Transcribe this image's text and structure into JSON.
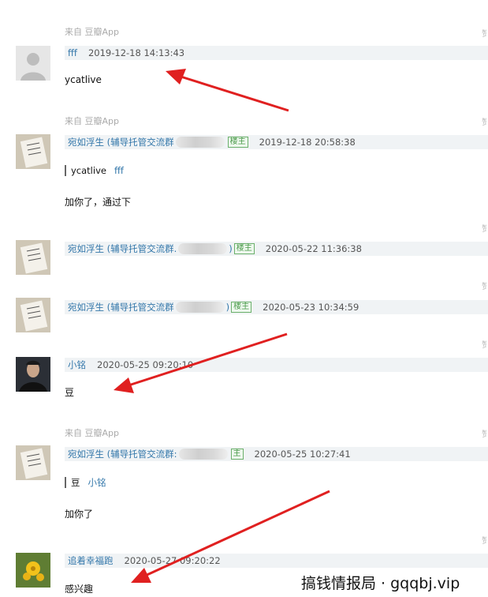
{
  "source_label": "来自 豆瓣App",
  "corner_glyph": "赞",
  "comments": [
    {
      "name": "fff",
      "time": "2019-12-18 14:13:43",
      "content": "ycatlive"
    },
    {
      "name": "宛如浮生 (辅导托管交流群",
      "time": "2019-12-18 20:58:38",
      "badge": "楼主",
      "quote_text": "ycatlive",
      "quote_name": "fff",
      "content": "加你了，通过下"
    },
    {
      "name": "宛如浮生 (辅导托管交流群.",
      "close_paren": ")",
      "time": "2020-05-22 11:36:38",
      "badge": "楼主"
    },
    {
      "name": "宛如浮生 (辅导托管交流群",
      "close_paren": ")",
      "time": "2020-05-23 10:34:59",
      "badge": "楼主"
    },
    {
      "name": "小铭",
      "time": "2020-05-25 09:20:10",
      "content": "豆"
    },
    {
      "name": "宛如浮生 (辅导托管交流群:",
      "time": "2020-05-25 10:27:41",
      "badge": "主",
      "quote_text": "豆",
      "quote_name": "小铭",
      "content": "加你了"
    },
    {
      "name": "追着幸福跑",
      "time": "2020-05-27 09:20:22",
      "content": "感兴趣"
    }
  ],
  "watermark": "搞钱情报局 · gqqbj.vip",
  "colors": {
    "arrow": "#e02020",
    "link": "#3377aa",
    "badge_green": "#4a9a4a",
    "header_bg": "#f0f3f5"
  }
}
